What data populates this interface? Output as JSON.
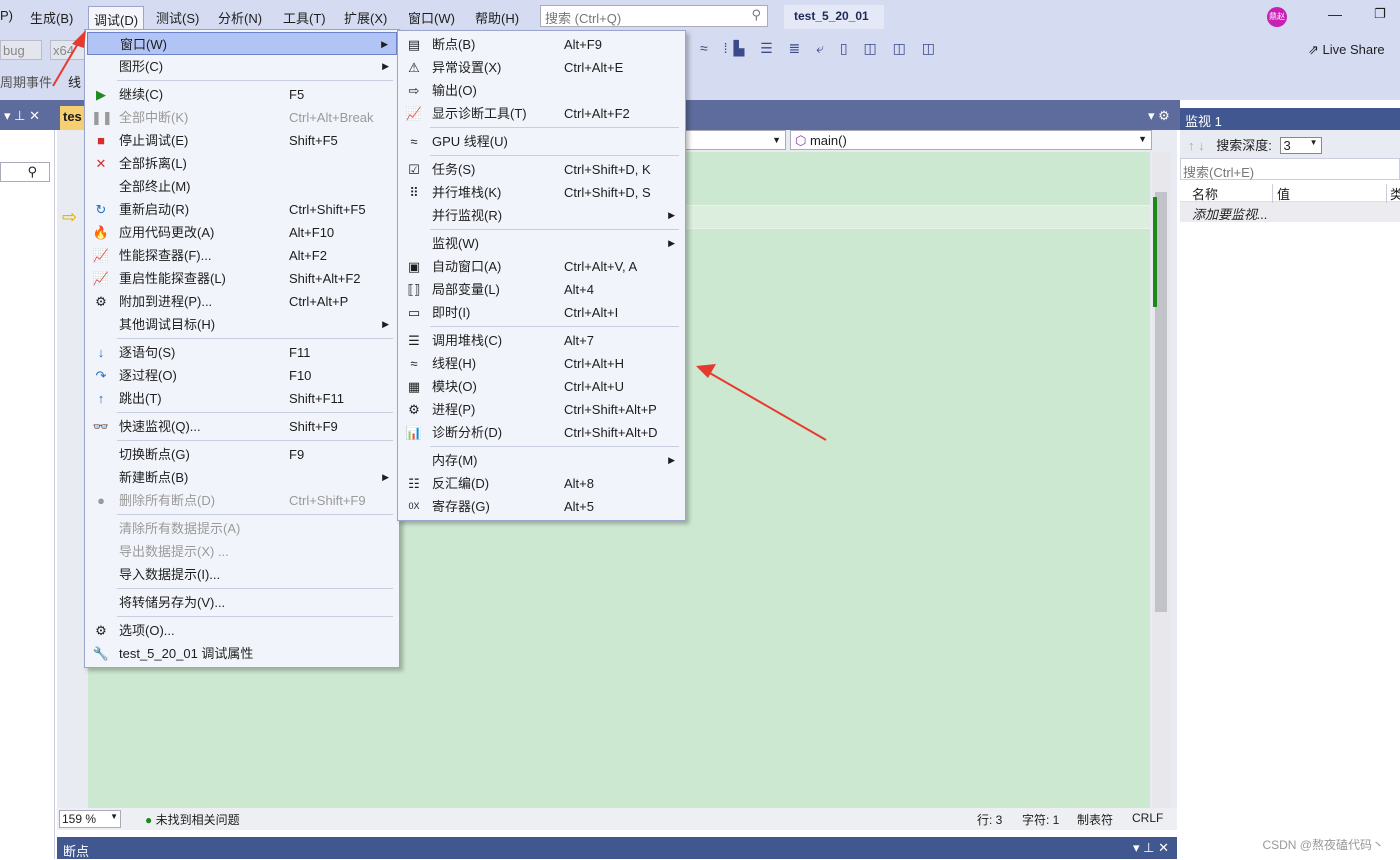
{
  "menubar": [
    "P)",
    "生成(B)",
    "调试(D)",
    "测试(S)",
    "分析(N)",
    "工具(T)",
    "扩展(X)",
    "窗口(W)",
    "帮助(H)"
  ],
  "search_placeholder": "搜索 (Ctrl+Q)",
  "project": "test_5_20_01",
  "avatar": "鼎赵",
  "live_share": "Live Share",
  "toolbar": {
    "config": "bug",
    "platform": "x64",
    "events": "周期事件",
    "thread": "线"
  },
  "editor": {
    "tab": "tes",
    "function_dropdown": "main()"
  },
  "debug_menu": [
    {
      "icon": "",
      "label": "窗口(W)",
      "submenu": true,
      "highlighted": true
    },
    {
      "icon": "",
      "label": "图形(C)",
      "submenu": true
    },
    {
      "sep": true
    },
    {
      "icon": "▶",
      "label": "继续(C)",
      "shortcut": "F5",
      "color": "#1e8a1e"
    },
    {
      "icon": "❚❚",
      "label": "全部中断(K)",
      "shortcut": "Ctrl+Alt+Break",
      "disabled": true
    },
    {
      "icon": "■",
      "label": "停止调试(E)",
      "shortcut": "Shift+F5",
      "color": "#d32f2f"
    },
    {
      "icon": "✕",
      "label": "全部拆离(L)",
      "color": "#d32f2f"
    },
    {
      "icon": "",
      "label": "全部终止(M)"
    },
    {
      "icon": "↻",
      "label": "重新启动(R)",
      "shortcut": "Ctrl+Shift+F5",
      "color": "#1f6fc4"
    },
    {
      "icon": "🔥",
      "label": "应用代码更改(A)",
      "shortcut": "Alt+F10",
      "color": "#d32f2f"
    },
    {
      "icon": "📈",
      "label": "性能探查器(F)...",
      "shortcut": "Alt+F2"
    },
    {
      "icon": "📈",
      "label": "重启性能探查器(L)",
      "shortcut": "Shift+Alt+F2"
    },
    {
      "icon": "⚙",
      "label": "附加到进程(P)...",
      "shortcut": "Ctrl+Alt+P"
    },
    {
      "icon": "",
      "label": "其他调试目标(H)",
      "submenu": true
    },
    {
      "sep": true
    },
    {
      "icon": "↓",
      "label": "逐语句(S)",
      "shortcut": "F11",
      "color": "#1f6fc4"
    },
    {
      "icon": "↷",
      "label": "逐过程(O)",
      "shortcut": "F10",
      "color": "#1f6fc4"
    },
    {
      "icon": "↑",
      "label": "跳出(T)",
      "shortcut": "Shift+F11",
      "color": "#1f6fc4"
    },
    {
      "sep": true
    },
    {
      "icon": "👓",
      "label": "快速监视(Q)...",
      "shortcut": "Shift+F9"
    },
    {
      "sep": true
    },
    {
      "icon": "",
      "label": "切换断点(G)",
      "shortcut": "F9"
    },
    {
      "icon": "",
      "label": "新建断点(B)",
      "submenu": true
    },
    {
      "icon": "●",
      "label": "删除所有断点(D)",
      "shortcut": "Ctrl+Shift+F9",
      "disabled": true
    },
    {
      "sep": true
    },
    {
      "icon": "",
      "label": "清除所有数据提示(A)",
      "disabled": true
    },
    {
      "icon": "",
      "label": "导出数据提示(X) ...",
      "disabled": true
    },
    {
      "icon": "",
      "label": "导入数据提示(I)..."
    },
    {
      "sep": true
    },
    {
      "icon": "",
      "label": "将转储另存为(V)..."
    },
    {
      "sep": true
    },
    {
      "icon": "⚙",
      "label": "选项(O)..."
    },
    {
      "icon": "🔧",
      "label": "test_5_20_01 调试属性"
    }
  ],
  "window_submenu": [
    {
      "icon": "▤",
      "label": "断点(B)",
      "shortcut": "Alt+F9"
    },
    {
      "icon": "⚠",
      "label": "异常设置(X)",
      "shortcut": "Ctrl+Alt+E"
    },
    {
      "icon": "⇨",
      "label": "输出(O)"
    },
    {
      "icon": "📈",
      "label": "显示诊断工具(T)",
      "shortcut": "Ctrl+Alt+F2"
    },
    {
      "sep": true
    },
    {
      "icon": "≈",
      "label": "GPU 线程(U)"
    },
    {
      "sep": true
    },
    {
      "icon": "☑",
      "label": "任务(S)",
      "shortcut": "Ctrl+Shift+D, K"
    },
    {
      "icon": "⠿",
      "label": "并行堆栈(K)",
      "shortcut": "Ctrl+Shift+D, S"
    },
    {
      "icon": "",
      "label": "并行监视(R)",
      "submenu": true
    },
    {
      "sep": true
    },
    {
      "icon": "",
      "label": "监视(W)",
      "submenu": true
    },
    {
      "icon": "▣",
      "label": "自动窗口(A)",
      "shortcut": "Ctrl+Alt+V, A"
    },
    {
      "icon": "⟦⟧",
      "label": "局部变量(L)",
      "shortcut": "Alt+4"
    },
    {
      "icon": "▭",
      "label": "即时(I)",
      "shortcut": "Ctrl+Alt+I"
    },
    {
      "sep": true
    },
    {
      "icon": "☰",
      "label": "调用堆栈(C)",
      "shortcut": "Alt+7"
    },
    {
      "icon": "≈",
      "label": "线程(H)",
      "shortcut": "Ctrl+Alt+H"
    },
    {
      "icon": "▦",
      "label": "模块(O)",
      "shortcut": "Ctrl+Alt+U"
    },
    {
      "icon": "⚙",
      "label": "进程(P)",
      "shortcut": "Ctrl+Shift+Alt+P"
    },
    {
      "icon": "📊",
      "label": "诊断分析(D)",
      "shortcut": "Ctrl+Shift+Alt+D"
    },
    {
      "sep": true
    },
    {
      "icon": "",
      "label": "内存(M)",
      "submenu": true
    },
    {
      "icon": "☷",
      "label": "反汇编(D)",
      "shortcut": "Alt+8"
    },
    {
      "icon": "0X",
      "label": "寄存器(G)",
      "shortcut": "Alt+5"
    }
  ],
  "watch": {
    "title": "监视 1",
    "depth_label": "搜索深度:",
    "depth": "3",
    "search_placeholder": "搜索(Ctrl+E)",
    "cols": [
      "名称",
      "值",
      "类"
    ],
    "add_hint": "添加要监视..."
  },
  "status": {
    "zoom": "159 %",
    "issues": "未找到相关问题",
    "line": "行: 3",
    "char": "字符: 1",
    "tabs": "制表符",
    "eol": "CRLF"
  },
  "bottom_panel": "断点",
  "watermark": "CSDN @熬夜磕代码丶"
}
